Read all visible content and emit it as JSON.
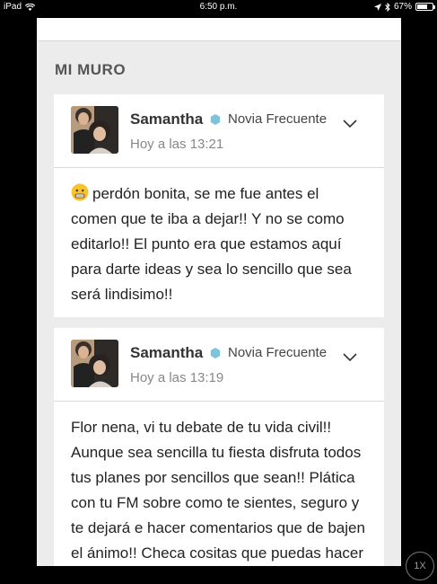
{
  "status_bar": {
    "device": "iPad",
    "time": "6:50 p.m.",
    "battery": "67%",
    "battery_level": 0.67
  },
  "section": {
    "title": "MI MURO"
  },
  "posts": [
    {
      "author": "Samantha",
      "badge": "Novia Frecuente",
      "time": "Hoy a las 13:21",
      "emoji": "😬",
      "text": "perdón bonita, se me fue antes el comen que te iba a dejar!! Y no se como editarlo!! El punto era que estamos aquí para darte ideas y sea lo sencillo que sea será lindisimo!!"
    },
    {
      "author": "Samantha",
      "badge": "Novia Frecuente",
      "time": "Hoy a las 13:19",
      "text": "Flor nena, vi tu debate de tu vida civil!! Aunque sea sencilla tu fiesta disfruta todos tus planes por sencillos que sean!! Plática con tu FM sobre como te sientes, seguro y te dejará e hacer comentarios que de bajen el ánimo!! Checa cositas que puedas hacer"
    }
  ],
  "colors": {
    "badge": "#7ec3dc",
    "background": "#ececec"
  },
  "zoom_button": {
    "label": "1X"
  }
}
